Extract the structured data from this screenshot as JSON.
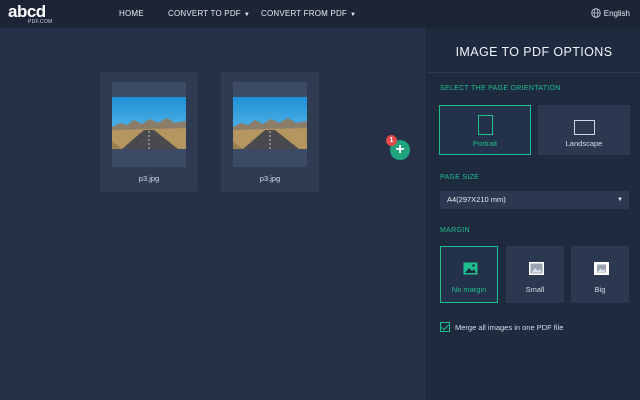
{
  "header": {
    "logo_text": "abcd",
    "logo_sub": "PDF.COM",
    "nav": [
      {
        "label": "HOME"
      },
      {
        "label": "CONVERT TO PDF",
        "caret": "▼"
      },
      {
        "label": "CONVERT FROM PDF",
        "caret": "▼"
      }
    ],
    "language": "English"
  },
  "workspace": {
    "files": [
      {
        "name": "p3.jpg"
      },
      {
        "name": "p3.jpg"
      }
    ],
    "add_button": "+",
    "file_count_badge": "1"
  },
  "panel": {
    "title": "IMAGE TO PDF OPTIONS",
    "orientation": {
      "label": "SELECT THE PAGE ORIENTATION",
      "options": [
        {
          "label": "Portrait",
          "selected": true
        },
        {
          "label": "Landscape",
          "selected": false
        }
      ]
    },
    "page_size": {
      "label": "PAGE SIZE",
      "selected": "A4(297X210 mm)",
      "arrow": "▼"
    },
    "margin": {
      "label": "MARGIN",
      "options": [
        {
          "label": "No margin",
          "selected": true
        },
        {
          "label": "Small",
          "selected": false
        },
        {
          "label": "Big",
          "selected": false
        }
      ]
    },
    "merge": {
      "label": "Merge all images in one PDF file",
      "checked": true
    }
  },
  "colors": {
    "accent": "#1fbf8f",
    "badge": "#e24a4a",
    "panel_bg": "#1e2a3e",
    "workspace_bg": "#263147",
    "topbar_bg": "#1b2536"
  }
}
